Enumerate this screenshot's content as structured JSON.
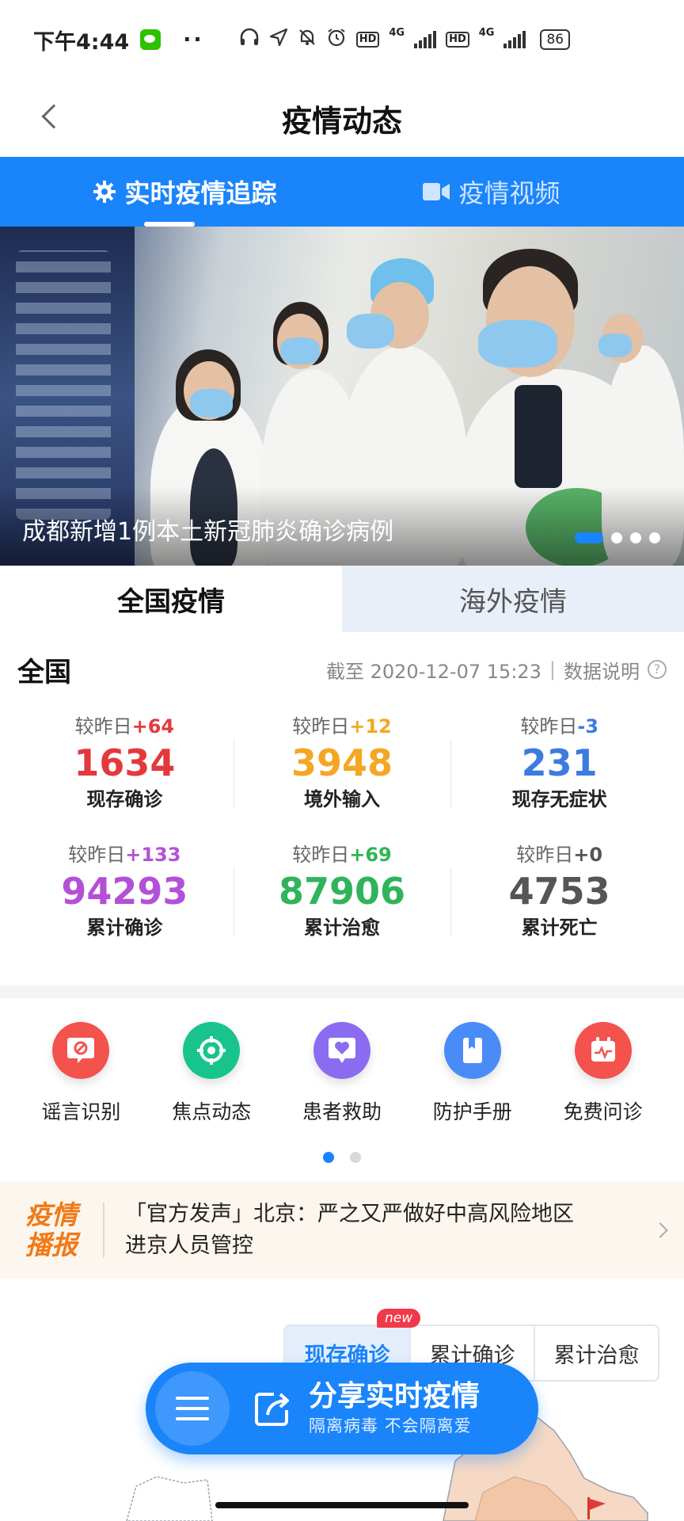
{
  "status_bar": {
    "time": "下午4:44",
    "dots": "··",
    "battery": "86",
    "hd": "HD",
    "net": "4G"
  },
  "header": {
    "title": "疫情动态"
  },
  "tabs": [
    {
      "label": "实时疫情追踪",
      "active": true
    },
    {
      "label": "疫情视频",
      "active": false
    }
  ],
  "banner": {
    "caption": "成都新增1例本土新冠肺炎确诊病例"
  },
  "region_tabs": [
    {
      "label": "全国疫情",
      "active": true
    },
    {
      "label": "海外疫情",
      "active": false
    }
  ],
  "stats": {
    "title": "全国",
    "as_of": "截至 2020-12-07 15:23",
    "separator": "|",
    "data_note": "数据说明",
    "delta_prefix": "较昨日",
    "items": [
      {
        "delta": "+64",
        "value": "1634",
        "label": "现存确诊",
        "color": "#e4393c"
      },
      {
        "delta": "+12",
        "value": "3948",
        "label": "境外输入",
        "color": "#f5a623"
      },
      {
        "delta": "-3",
        "value": "231",
        "label": "现存无症状",
        "color": "#3c7be0"
      },
      {
        "delta": "+133",
        "value": "94293",
        "label": "累计确诊",
        "color": "#b450d8"
      },
      {
        "delta": "+69",
        "value": "87906",
        "label": "累计治愈",
        "color": "#2fb45a"
      },
      {
        "delta": "+0",
        "value": "4753",
        "label": "累计死亡",
        "color": "#555555"
      }
    ]
  },
  "quick_links": [
    {
      "label": "谣言识别",
      "icon": "rumor-icon",
      "color": "#f4524d"
    },
    {
      "label": "焦点动态",
      "icon": "focus-icon",
      "color": "#18c48c"
    },
    {
      "label": "患者救助",
      "icon": "heart-icon",
      "color": "#8b6cf0"
    },
    {
      "label": "防护手册",
      "icon": "book-icon",
      "color": "#4a8cf7"
    },
    {
      "label": "免费问诊",
      "icon": "consult-icon",
      "color": "#f4524d"
    }
  ],
  "ticker": {
    "badge_line1": "疫情",
    "badge_line2": "播报",
    "text_line1": "「官方发声」北京：严之又严做好中高风险地区",
    "text_line2": "进京人员管控"
  },
  "map_toggle": {
    "options": [
      "现存确诊",
      "累计确诊",
      "累计治愈"
    ],
    "new_badge": "new"
  },
  "share": {
    "title": "分享实时疫情",
    "subtitle": "隔离病毒  不会隔离爱"
  },
  "colors": {
    "primary": "#1a84fb",
    "ticker_bg": "#fdf6ee",
    "ticker_badge": "#f07a18"
  }
}
